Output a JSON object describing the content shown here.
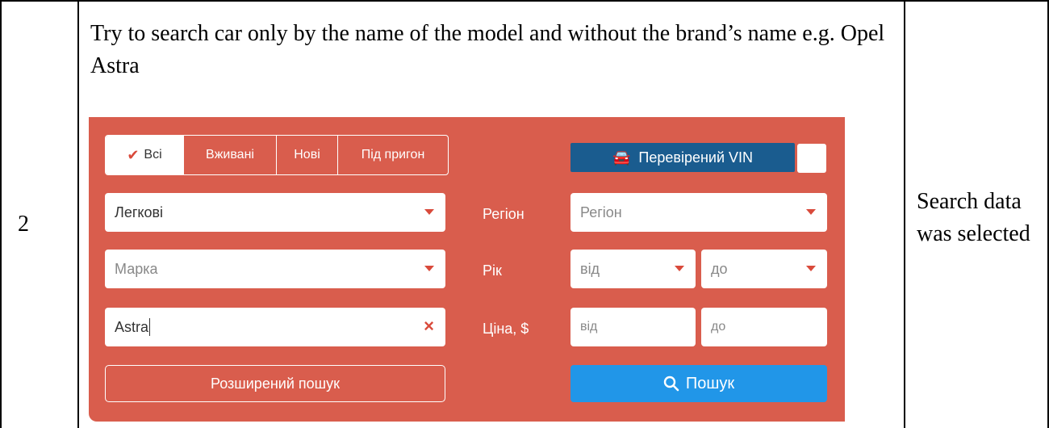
{
  "table": {
    "row_number": "2",
    "step_text": "Try to search car only by the name of the model and without the brand’s name e.g. Opel Astra",
    "result_text": "Search data was selected"
  },
  "search": {
    "tabs": [
      {
        "label": "Всі",
        "active": true
      },
      {
        "label": "Вживані",
        "active": false
      },
      {
        "label": "Нові",
        "active": false
      },
      {
        "label": "Під пригон",
        "active": false
      }
    ],
    "vin_label": "Перевірений VIN",
    "category_value": "Легкові",
    "brand_placeholder": "Марка",
    "model_value": "Astra",
    "region_label": "Регіон",
    "region_placeholder": "Регіон",
    "year_label": "Рік",
    "year_from": "від",
    "year_to": "до",
    "price_label": "Ціна, $",
    "price_from": "від",
    "price_to": "до",
    "advanced_label": "Розширений пошук",
    "search_label": "Пошук"
  },
  "icons": {
    "check": "check-icon",
    "car": "car-icon",
    "dropdown": "chevron-down-icon",
    "clear": "close-icon",
    "search": "search-icon"
  },
  "colors": {
    "panel": "#d95d4d",
    "vin_badge": "#1a5c8f",
    "search_button": "#2196e8",
    "accent": "#d94a3b"
  }
}
